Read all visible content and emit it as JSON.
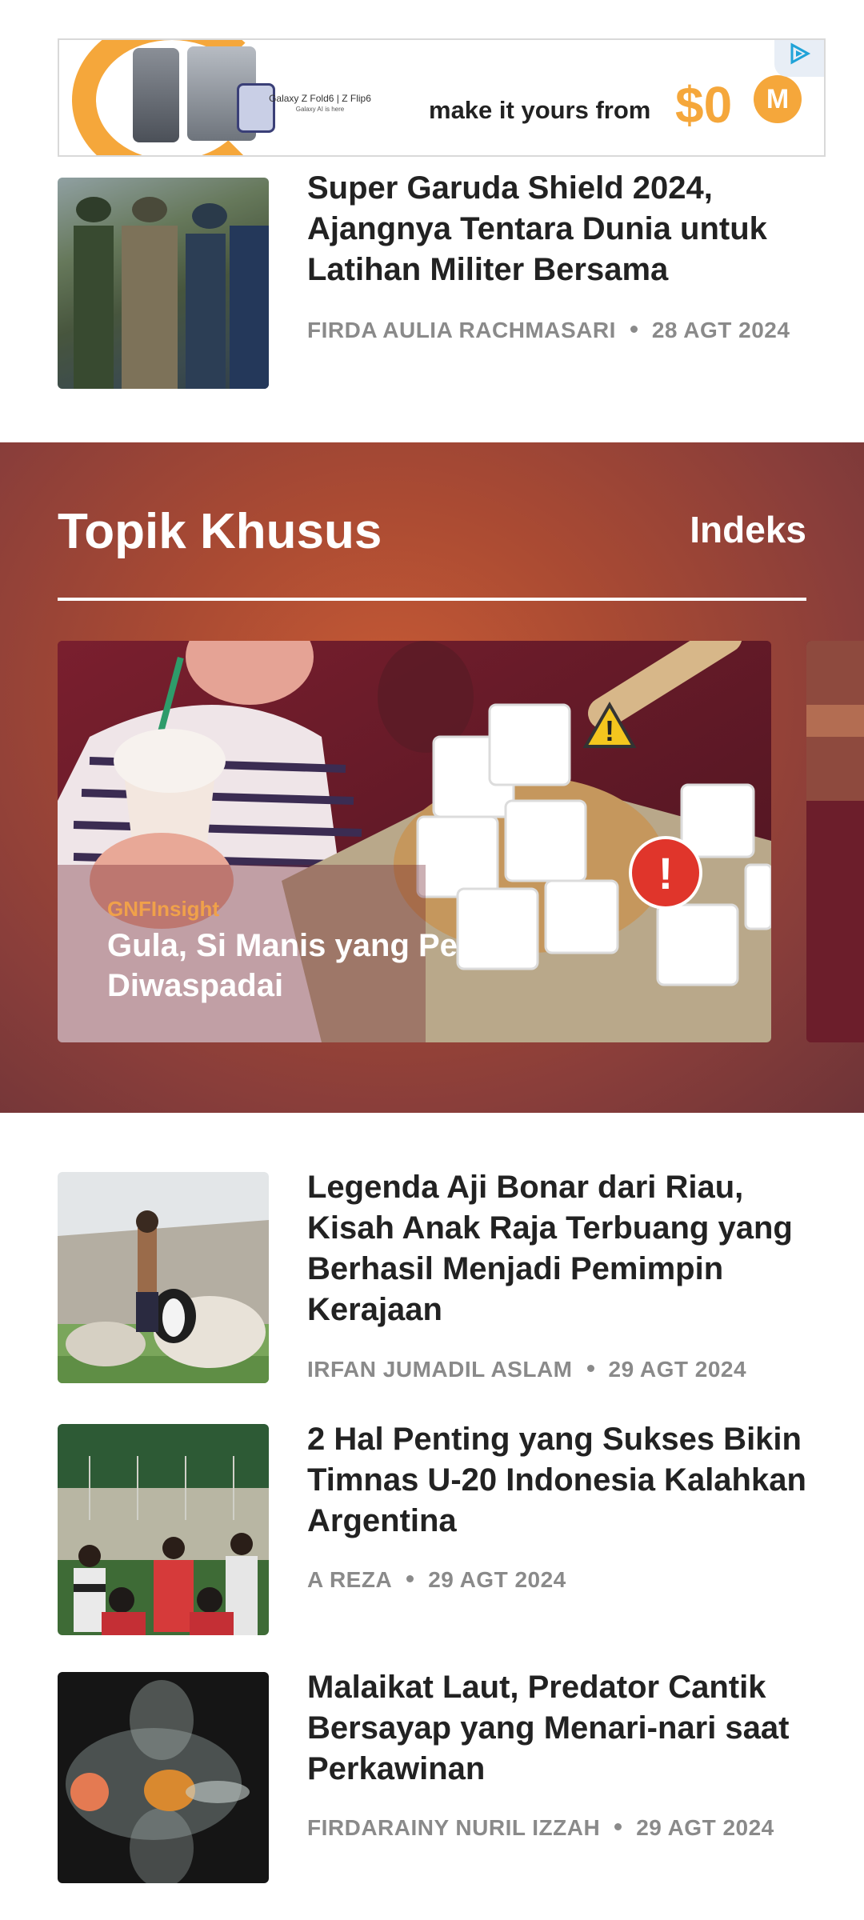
{
  "ad": {
    "product_text": "Galaxy Z Fold6 | Z Flip6",
    "product_subtext": "Galaxy AI is here",
    "tagline": "make it yours from",
    "price": "$0",
    "logo_letter": "M",
    "badge_icon": "ad-choices-icon"
  },
  "articles_top": [
    {
      "title": "Super Garuda Shield 2024, Ajangnya Tentara Dunia untuk Latihan Militer Bersama",
      "author": "FIRDA AULIA RACHMASARI",
      "date": "28 AGT 2024"
    }
  ],
  "special": {
    "title": "Topik Khusus",
    "index_link": "Indeks",
    "cards": [
      {
        "brand": "GNFInsight",
        "caption": "Gula, Si Manis yang Perlu Diwaspadai"
      }
    ]
  },
  "articles": [
    {
      "title": "Legenda Aji Bonar dari Riau, Kisah Anak Raja Terbuang yang Berhasil Menjadi Pemimpin Kerajaan",
      "author": "IRFAN JUMADIL ASLAM",
      "date": "29 AGT 2024"
    },
    {
      "title": "2 Hal Penting yang Sukses Bikin Timnas U-20 Indonesia Kalahkan Argentina",
      "author": "A REZA",
      "date": "29 AGT 2024"
    },
    {
      "title": "Malaikat Laut, Predator Cantik Bersayap yang Menari-nari saat Perkawinan",
      "author": "FIRDARAINY NURIL IZZAH",
      "date": "29 AGT 2024"
    }
  ]
}
